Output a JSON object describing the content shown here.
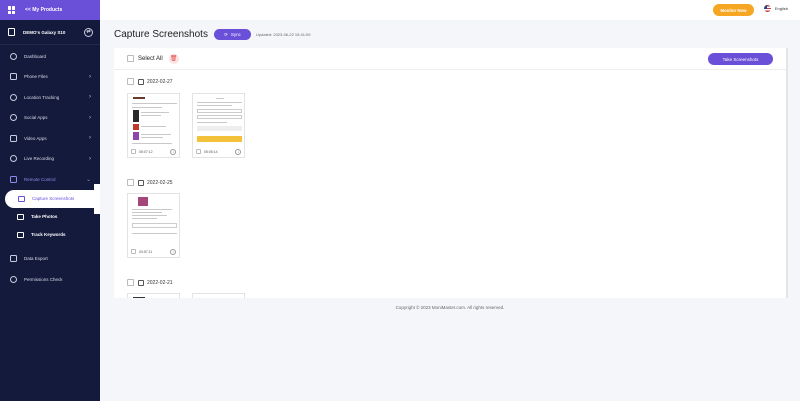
{
  "app": {
    "back_label": "<< My Products",
    "device_name": "DEMO's Galaxy S10",
    "monitor_now": "Monitor Now",
    "language": "English"
  },
  "sidebar": {
    "items": [
      {
        "label": "Dashboard"
      },
      {
        "label": "Phone Files"
      },
      {
        "label": "Location Tracking"
      },
      {
        "label": "Social Apps"
      },
      {
        "label": "Video Apps"
      },
      {
        "label": "Live Recording"
      },
      {
        "label": "Remote Control"
      },
      {
        "label": "Capture Screenshots"
      },
      {
        "label": "Take Photos"
      },
      {
        "label": "Track Keywords"
      },
      {
        "label": "Data Export"
      },
      {
        "label": "Permissions Check"
      }
    ]
  },
  "header": {
    "title": "Capture Screenshots",
    "sync_label": "Sync",
    "updated": "Updated: 2023-06-22 15:41:09"
  },
  "toolbar": {
    "select_all": "Select All",
    "take_screenshots": "Take Screenshots"
  },
  "groups": [
    {
      "date": "2022-02-27",
      "times": [
        "05:07:12",
        "05:05:14"
      ]
    },
    {
      "date": "2022-02-25",
      "times": [
        "00:57:11"
      ]
    },
    {
      "date": "2022-02-21",
      "times": []
    }
  ],
  "footer": {
    "copyright": "Copyright © 2023 MoniMaster.com. All rights reserved."
  },
  "colors": {
    "accent": "#6a4fd8",
    "sidebar_bg": "#141a3c",
    "monitor_button": "#f6a623",
    "delete": "#e24b4b"
  }
}
